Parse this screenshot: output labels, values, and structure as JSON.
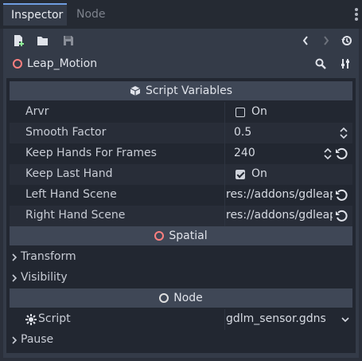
{
  "tabs": [
    {
      "label": "Inspector",
      "active": true
    },
    {
      "label": "Node",
      "active": false
    }
  ],
  "toolbar": {
    "icons": [
      "new-resource-icon",
      "open-folder-icon",
      "save-icon",
      "history-back-icon",
      "history-forward-icon",
      "object-history-icon"
    ]
  },
  "object": {
    "name": "Leap_Motion",
    "icons": [
      "search-icon",
      "property-tools-icon"
    ]
  },
  "sections": {
    "script_variables": "Script Variables",
    "spatial": "Spatial",
    "node": "Node"
  },
  "properties": [
    {
      "label": "Arvr",
      "type": "bool",
      "checked": false,
      "value": "On"
    },
    {
      "label": "Smooth Factor",
      "type": "number",
      "value": "0.5"
    },
    {
      "label": "Keep Hands For Frames",
      "type": "number",
      "value": "240"
    },
    {
      "label": "Keep Last Hand",
      "type": "bool",
      "checked": true,
      "value": "On"
    },
    {
      "label": "Left Hand Scene",
      "type": "path",
      "value": "res://addons/gdleap"
    },
    {
      "label": "Right Hand Scene",
      "type": "path",
      "value": "res://addons/gdleap"
    }
  ],
  "groups": {
    "transform": "Transform",
    "visibility": "Visibility",
    "pause": "Pause"
  },
  "script_prop": {
    "label": "Script",
    "value": "gdlm_sensor.gdns"
  },
  "colors": {
    "accent": "#6f9de0",
    "spatial": "#fc7f7f",
    "node": "#e0e0e0",
    "panel": "#343b48",
    "background": "#222731"
  }
}
